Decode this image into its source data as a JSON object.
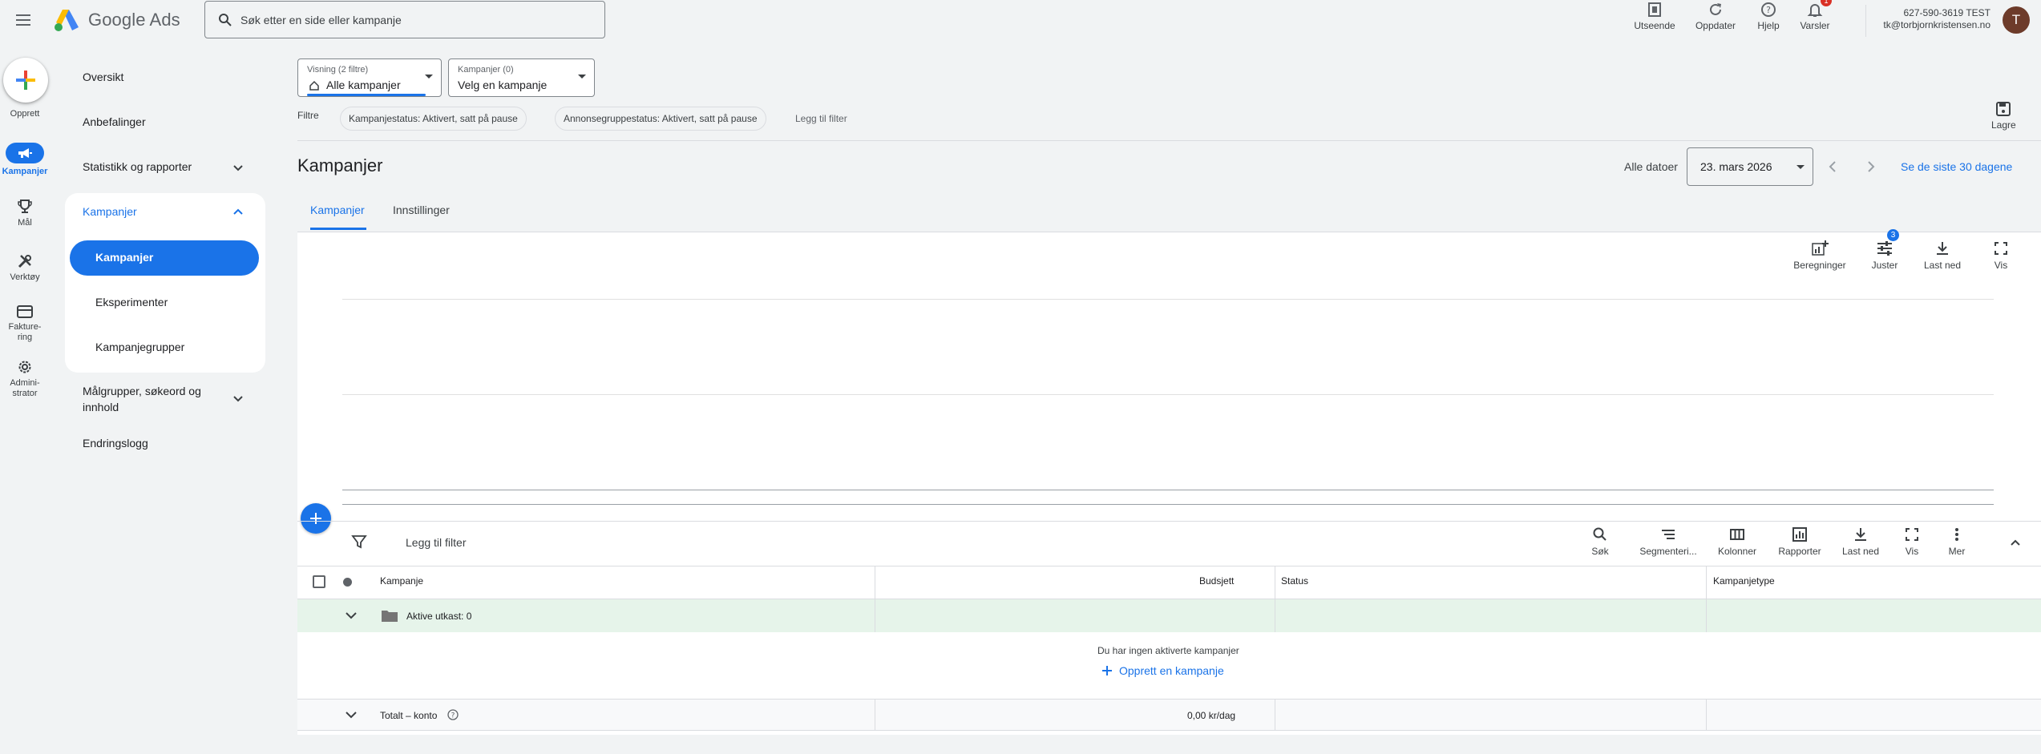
{
  "app": {
    "name": "Google Ads"
  },
  "search": {
    "placeholder": "Søk etter en side eller kampanje"
  },
  "top_actions": {
    "appearance": "Utseende",
    "refresh": "Oppdater",
    "help": "Hjelp",
    "notifications": "Varsler",
    "notifications_badge": "1"
  },
  "account": {
    "id": "627-590-3619 TEST",
    "email": "tk@torbjornkristensen.no",
    "avatar_letter": "T"
  },
  "rail": {
    "create": "Opprett",
    "campaigns": "Kampanjer",
    "goals": "Mål",
    "tools": "Verktøy",
    "billing_line1": "Fakture-",
    "billing_line2": "ring",
    "admin_line1": "Admini-",
    "admin_line2": "strator"
  },
  "sidebar": {
    "overview": "Oversikt",
    "recommendations": "Anbefalinger",
    "stats": "Statistikk og rapporter",
    "campaigns_group": "Kampanjer",
    "campaigns": "Kampanjer",
    "experiments": "Eksperimenter",
    "campaign_groups": "Kampanjegrupper",
    "audiences_line1": "Målgrupper, søkeord og",
    "audiences_line2": "innhold",
    "changelog": "Endringslogg"
  },
  "view_select": {
    "small": "Visning (2 filtre)",
    "value": "Alle kampanjer"
  },
  "campaign_select": {
    "small": "Kampanjer (0)",
    "value": "Velg en kampanje"
  },
  "filters": {
    "label": "Filtre",
    "chip1": "Kampanjestatus: Aktivert, satt på pause",
    "chip2": "Annonsegruppestatus: Aktivert, satt på pause",
    "add": "Legg til filter"
  },
  "save_label": "Lagre",
  "page_title": "Kampanjer",
  "date": {
    "all_dates": "Alle datoer",
    "value": "23. mars 2026",
    "range": "Se de siste 30 dagene"
  },
  "tabs": {
    "campaigns": "Kampanjer",
    "settings": "Innstillinger"
  },
  "chart_tools": {
    "calc": "Beregninger",
    "adjust": "Juster",
    "adjust_badge": "3",
    "download": "Last ned",
    "view": "Vis"
  },
  "table_toolbar": {
    "add_filter": "Legg til filter",
    "search": "Søk",
    "segment": "Segmenteri...",
    "columns": "Kolonner",
    "reports": "Rapporter",
    "download": "Last ned",
    "view": "Vis",
    "more": "Mer"
  },
  "table": {
    "headers": {
      "campaign": "Kampanje",
      "budget": "Budsjett",
      "status": "Status",
      "type": "Kampanjetype"
    },
    "draft_row": "Aktive utkast: 0",
    "empty_text": "Du har ingen aktiverte kampanjer",
    "create_link": "Opprett en kampanje",
    "total_label": "Totalt – konto",
    "total_budget": "0,00 kr/dag"
  }
}
